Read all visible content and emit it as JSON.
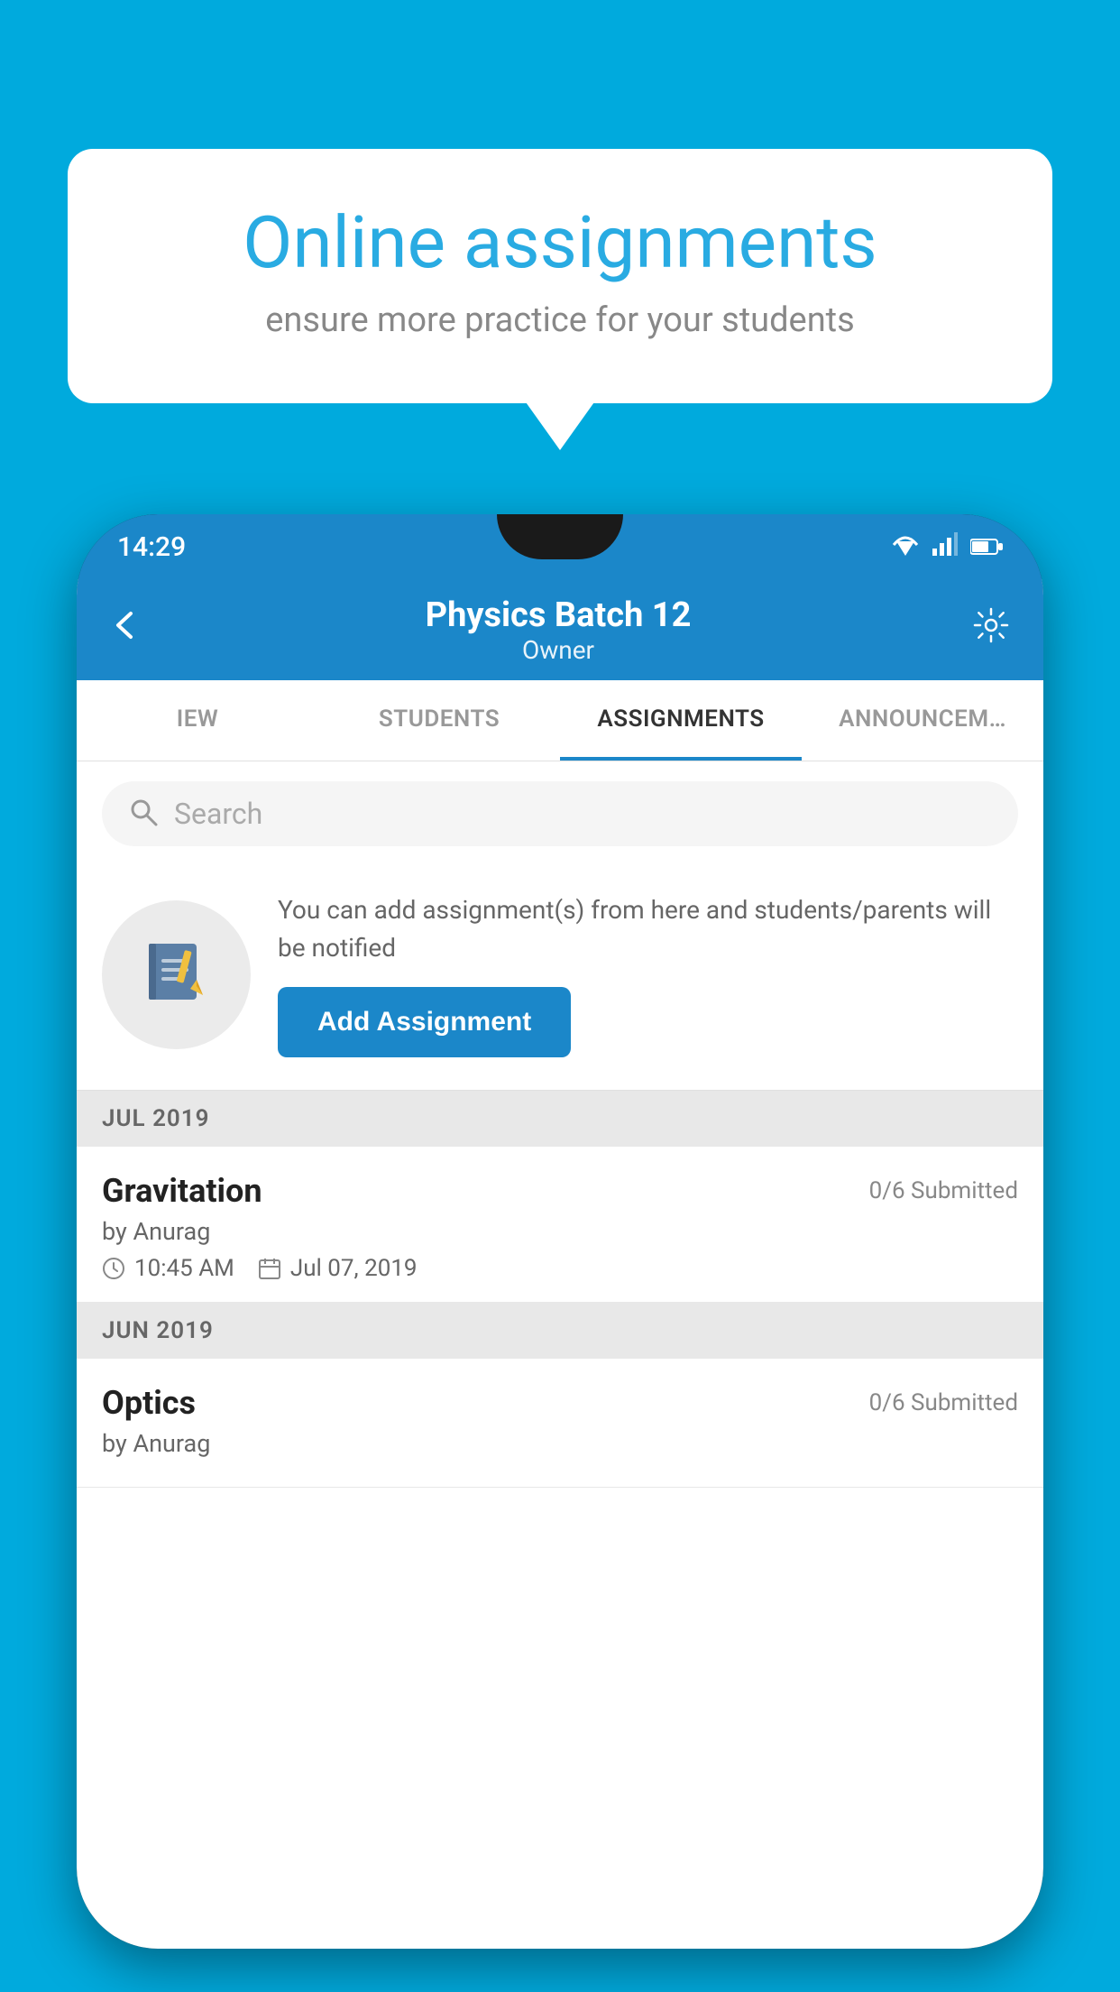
{
  "background_color": "#00AADD",
  "speech_bubble": {
    "title": "Online assignments",
    "subtitle": "ensure more practice for your students"
  },
  "status_bar": {
    "time": "14:29",
    "wifi_icon": "wifi-icon",
    "signal_icon": "signal-icon",
    "battery_icon": "battery-icon"
  },
  "header": {
    "title": "Physics Batch 12",
    "subtitle": "Owner",
    "back_label": "back",
    "settings_label": "settings"
  },
  "tabs": [
    {
      "label": "IEW",
      "active": false
    },
    {
      "label": "STUDENTS",
      "active": false
    },
    {
      "label": "ASSIGNMENTS",
      "active": true
    },
    {
      "label": "ANNOUNCEM…",
      "active": false
    }
  ],
  "search": {
    "placeholder": "Search"
  },
  "promo": {
    "description": "You can add assignment(s) from here and students/parents will be notified",
    "button_label": "Add Assignment"
  },
  "assignment_groups": [
    {
      "month_label": "JUL 2019",
      "assignments": [
        {
          "name": "Gravitation",
          "submitted": "0/6 Submitted",
          "by": "by Anurag",
          "time": "10:45 AM",
          "date": "Jul 07, 2019"
        }
      ]
    },
    {
      "month_label": "JUN 2019",
      "assignments": [
        {
          "name": "Optics",
          "submitted": "0/6 Submitted",
          "by": "by Anurag",
          "time": "",
          "date": ""
        }
      ]
    }
  ]
}
